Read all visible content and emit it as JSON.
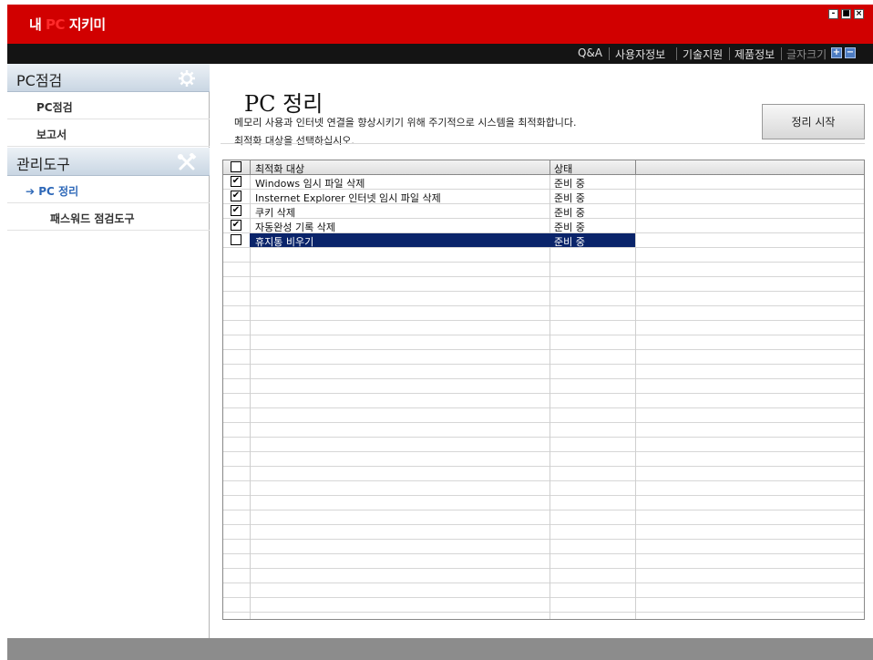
{
  "window": {
    "title_prefix": "내 ",
    "title_accent": "PC",
    "title_suffix": " 지키미",
    "controls": {
      "minimize": "-",
      "maximize": "■",
      "close": "×"
    }
  },
  "topnav": {
    "links": [
      "Q&A",
      "사용자정보",
      "기술지원",
      "제품정보"
    ],
    "font_size_label": "글자크기",
    "font_plus": "+",
    "font_minus": "−"
  },
  "sidebar": {
    "sections": [
      {
        "label": "PC점검",
        "icon": "gear-icon",
        "items": [
          {
            "label": "PC점검",
            "active": false
          },
          {
            "label": "보고서",
            "active": false
          }
        ]
      },
      {
        "label": "관리도구",
        "icon": "tools-icon",
        "items": [
          {
            "label": "PC 정리",
            "active": true,
            "marker": "➔"
          },
          {
            "label": "패스워드 점검도구",
            "active": false
          }
        ]
      }
    ]
  },
  "main": {
    "title": "PC 정리",
    "description_line1": "메모리 사용과 인터넷 연결을 향상시키기 위해 주기적으로 시스템을 최적화합니다.",
    "description_line2": "최적화 대상을 선택하십시오.",
    "start_button": "정리 시작",
    "table": {
      "columns": [
        "최적화 대상",
        "상태"
      ],
      "check_mark": "✔",
      "rows": [
        {
          "target": "Windows 임시 파일 삭제",
          "status": "준비 중",
          "checked": true,
          "selected": false
        },
        {
          "target": "Insternet Explorer 인터넷 임시 파일 삭제",
          "status": "준비 중",
          "checked": true,
          "selected": false
        },
        {
          "target": "쿠키 삭제",
          "status": "준비 중",
          "checked": true,
          "selected": false
        },
        {
          "target": "자동완성 기록 삭제",
          "status": "준비 중",
          "checked": true,
          "selected": false
        },
        {
          "target": "휴지통 비우기",
          "status": "준비 중",
          "checked": false,
          "selected": true
        }
      ]
    }
  },
  "colors": {
    "title_bar": "#d10000",
    "nav_bar": "#141414",
    "selection": "#0a246a",
    "active_nav": "#2e68b8",
    "status_bar": "#8c8c8c"
  }
}
